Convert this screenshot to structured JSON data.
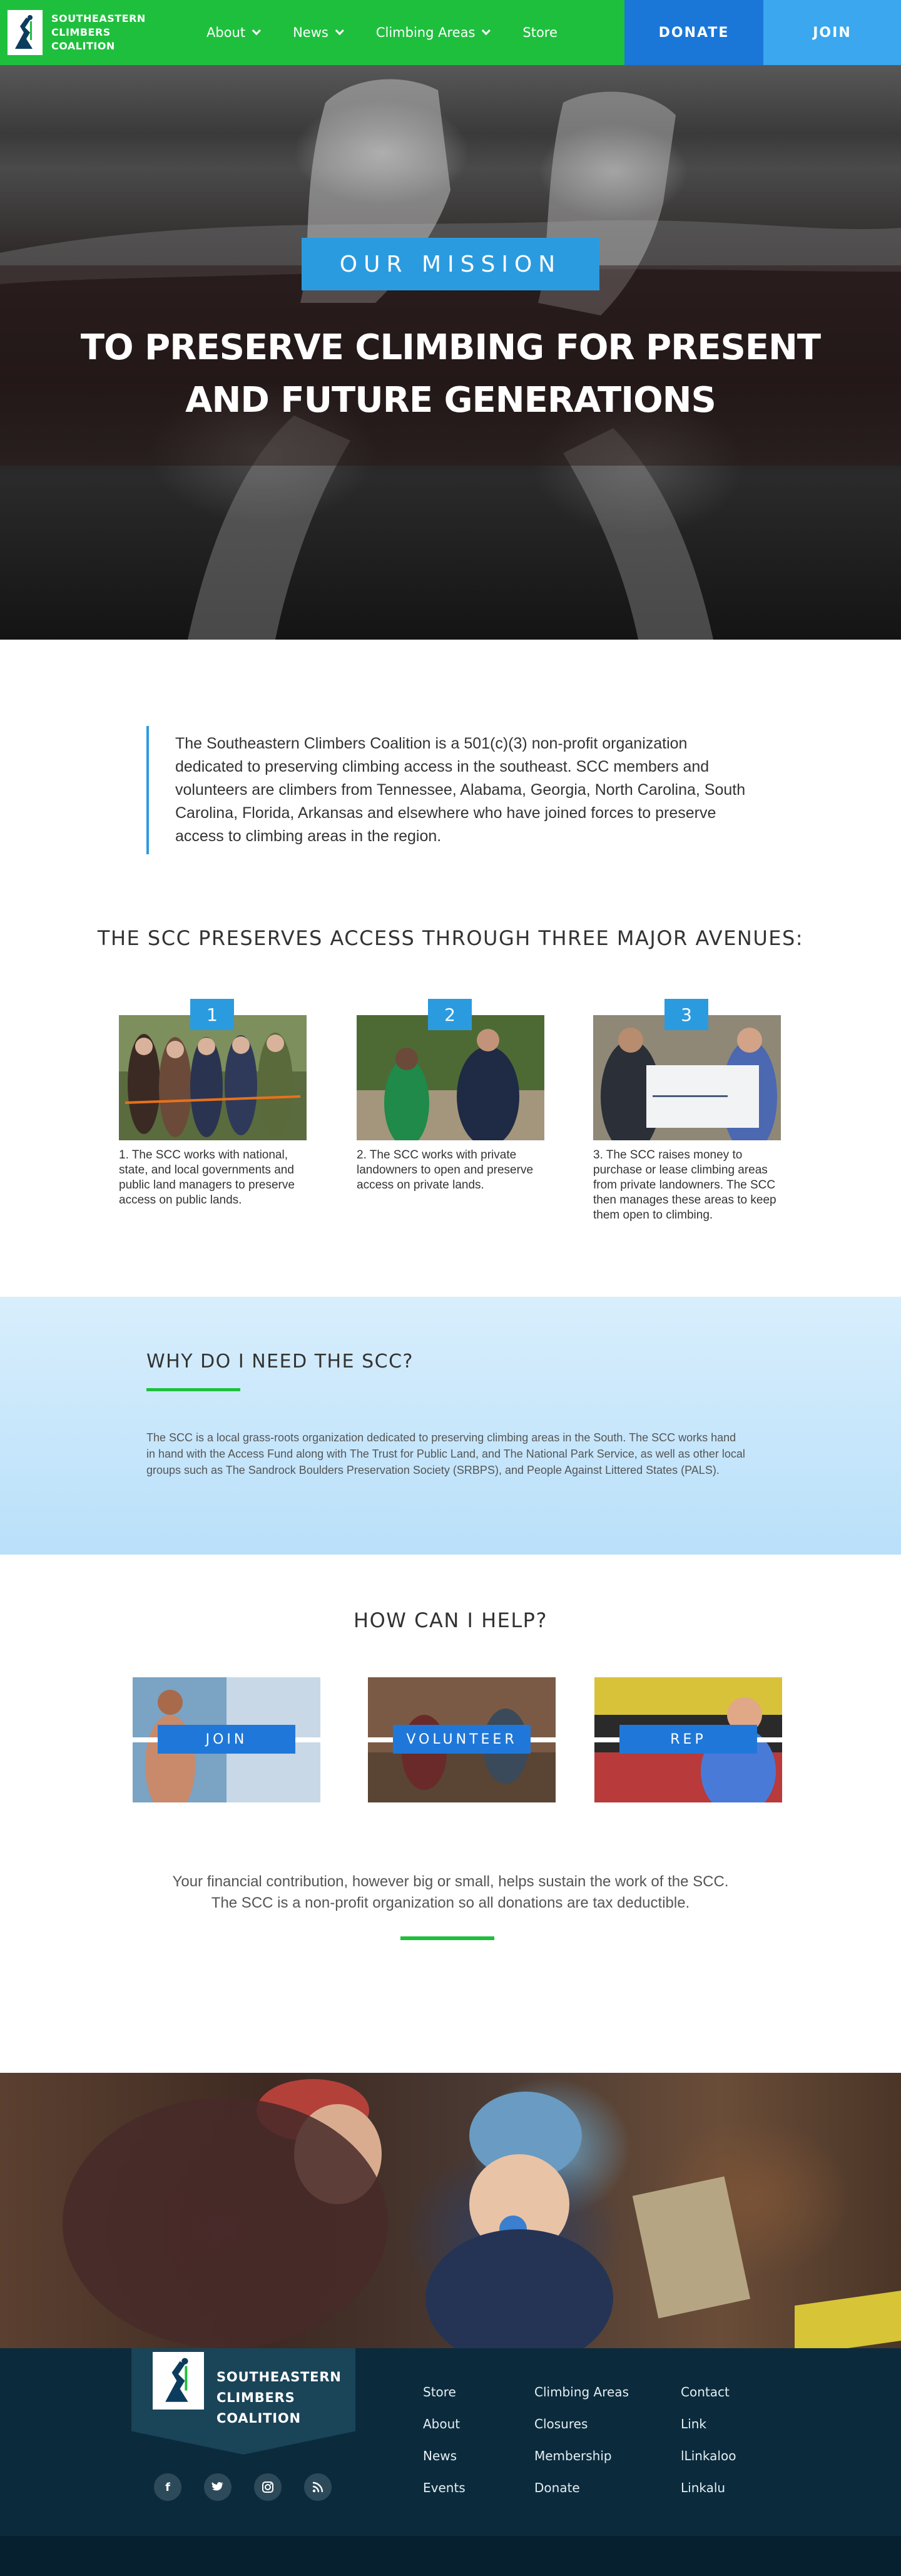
{
  "nav": {
    "logo_lines": [
      "SOUTHEASTERN",
      "CLIMBERS",
      "COALITION"
    ],
    "links": [
      {
        "label": "About",
        "dropdown": true
      },
      {
        "label": "News",
        "dropdown": true
      },
      {
        "label": "Climbing Areas",
        "dropdown": true
      },
      {
        "label": "Store",
        "dropdown": false
      }
    ],
    "donate_label": "DONATE",
    "join_label": "JOIN"
  },
  "hero": {
    "badge": "OUR MISSION",
    "title_line1": "TO PRESERVE CLIMBING FOR PRESENT",
    "title_line2": "AND FUTURE GENERATIONS"
  },
  "intro": {
    "text": "The Southeastern Climbers Coalition is a 501(c)(3) non-profit organization dedicated to preserving climbing access in the southeast. SCC members and volunteers are climbers from Tennessee, Alabama, Georgia, North Carolina, South Carolina, Florida, Arkansas and elsewhere who have joined forces to preserve access to climbing areas in the region."
  },
  "avenues": {
    "title": "THE SCC PRESERVES ACCESS THROUGH THREE MAJOR AVENUES:",
    "items": [
      {
        "num": "1",
        "caption": "1. The SCC works with national, state, and local governments and public land managers to preserve access on public lands."
      },
      {
        "num": "2",
        "caption": "2. The SCC works with private landowners to open and preserve access on private lands."
      },
      {
        "num": "3",
        "caption": "3. The SCC raises money to purchase or lease climbing areas from private landowners. The SCC then manages these areas to keep them open to climbing."
      }
    ]
  },
  "why": {
    "title": "WHY DO I NEED THE SCC?",
    "text": "The SCC is a local grass-roots organization dedicated to preserving climbing areas in the South. The SCC works hand in hand with the Access Fund along with The Trust for Public Land, and The National Park Service, as well as other local groups such as The Sandrock Boulders Preservation Society (SRBPS), and People Against Littered States (PALS)."
  },
  "help": {
    "title": "HOW CAN I HELP?",
    "cards": [
      {
        "label": "JOIN"
      },
      {
        "label": "VOLUNTEER"
      },
      {
        "label": "REP"
      }
    ],
    "contrib_line1": "Your financial contribution, however big or small, helps sustain the work of the SCC.",
    "contrib_line2": "The SCC is a non-profit organization so all donations are tax deductible."
  },
  "footer": {
    "logo_lines": [
      "SOUTHEASTERN",
      "CLIMBERS",
      "COALITION"
    ],
    "col1": [
      "Store",
      "About",
      "News",
      "Events"
    ],
    "col2": [
      "Climbing Areas",
      "Closures",
      "Membership",
      "Donate"
    ],
    "col3": [
      "Contact",
      "Link",
      "lLinkaloo",
      "Linkalu"
    ],
    "social_icons": [
      "facebook-icon",
      "twitter-icon",
      "instagram-icon",
      "rss-icon"
    ]
  },
  "colors": {
    "nav_green": "#1fbf3e",
    "donate_blue": "#1a77d8",
    "join_blue": "#3aa7ee",
    "accent_blue": "#2b9be0",
    "footer_navy": "#0b2b3d"
  }
}
